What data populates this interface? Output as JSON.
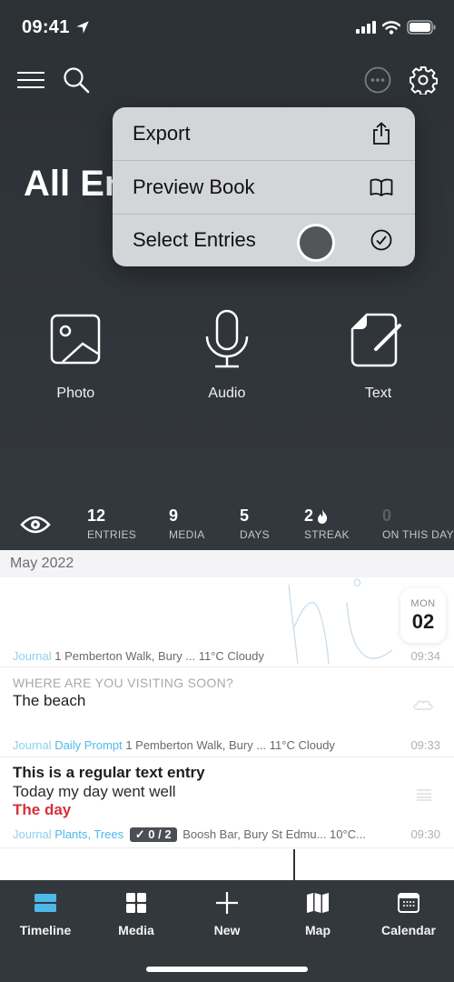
{
  "status_bar": {
    "time": "09:41"
  },
  "header": {
    "title": "All Entries",
    "menu_icon": "hamburger-icon",
    "search_icon": "search-icon",
    "more_icon": "ellipsis-circle-icon",
    "settings_icon": "gear-icon"
  },
  "context_menu": {
    "items": [
      {
        "label": "Export",
        "icon": "share-icon"
      },
      {
        "label": "Preview Book",
        "icon": "book-icon"
      },
      {
        "label": "Select Entries",
        "icon": "checkmark-circle-icon"
      }
    ]
  },
  "quick_create": [
    {
      "label": "Photo",
      "icon": "photo-icon"
    },
    {
      "label": "Audio",
      "icon": "microphone-icon"
    },
    {
      "label": "Text",
      "icon": "document-edit-icon"
    }
  ],
  "stats": [
    {
      "value": "12",
      "label": "ENTRIES"
    },
    {
      "value": "9",
      "label": "MEDIA"
    },
    {
      "value": "5",
      "label": "DAYS"
    },
    {
      "value": "2",
      "label": "STREAK"
    },
    {
      "value": "0",
      "label": "ON THIS DAY"
    }
  ],
  "timeline": {
    "month": "May 2022",
    "date_badge": {
      "dow": "MON",
      "day": "02"
    },
    "entries": [
      {
        "journal": "Journal",
        "location": "1 Pemberton Walk, Bury ... 11°C Cloudy",
        "time": "09:34"
      },
      {
        "prompt_question": "WHERE ARE YOU VISITING SOON?",
        "prompt_answer": "The beach",
        "journal": "Journal",
        "tag": "Daily Prompt",
        "location": "1 Pemberton Walk, Bury ... 11°C Cloudy",
        "time": "09:33"
      },
      {
        "title": "This is a regular text entry",
        "line1": "Today my day went well",
        "line2": "The day",
        "journal": "Journal",
        "tag": "Plants, Trees",
        "checklist": "✓ 0 / 2",
        "location": "Boosh Bar, Bury St Edmu... 10°C...",
        "time": "09:30"
      }
    ]
  },
  "tab_bar": {
    "active": "Timeline",
    "accent_color": "#4db8ea",
    "tabs": [
      {
        "label": "Timeline",
        "icon": "timeline-icon"
      },
      {
        "label": "Media",
        "icon": "grid-icon"
      },
      {
        "label": "New",
        "icon": "plus-icon"
      },
      {
        "label": "Map",
        "icon": "map-icon"
      },
      {
        "label": "Calendar",
        "icon": "calendar-icon"
      }
    ]
  }
}
